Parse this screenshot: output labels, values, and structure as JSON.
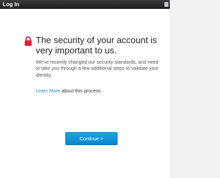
{
  "window": {
    "title": "Log In"
  },
  "main": {
    "heading": "The security of your account is very important to us.",
    "body": "We've recently changed our security standards, and need to take you through a few additional steps to validate your identity.",
    "learn_more_link": "Learn More",
    "learn_more_suffix": " about this process.",
    "continue_label": "Continue >"
  },
  "icons": {
    "lock": "lock-icon",
    "close": "close-icon"
  },
  "colors": {
    "accent": "#1e87c8",
    "lock": "#e0203a",
    "titlebar": "#2b2b2b"
  }
}
